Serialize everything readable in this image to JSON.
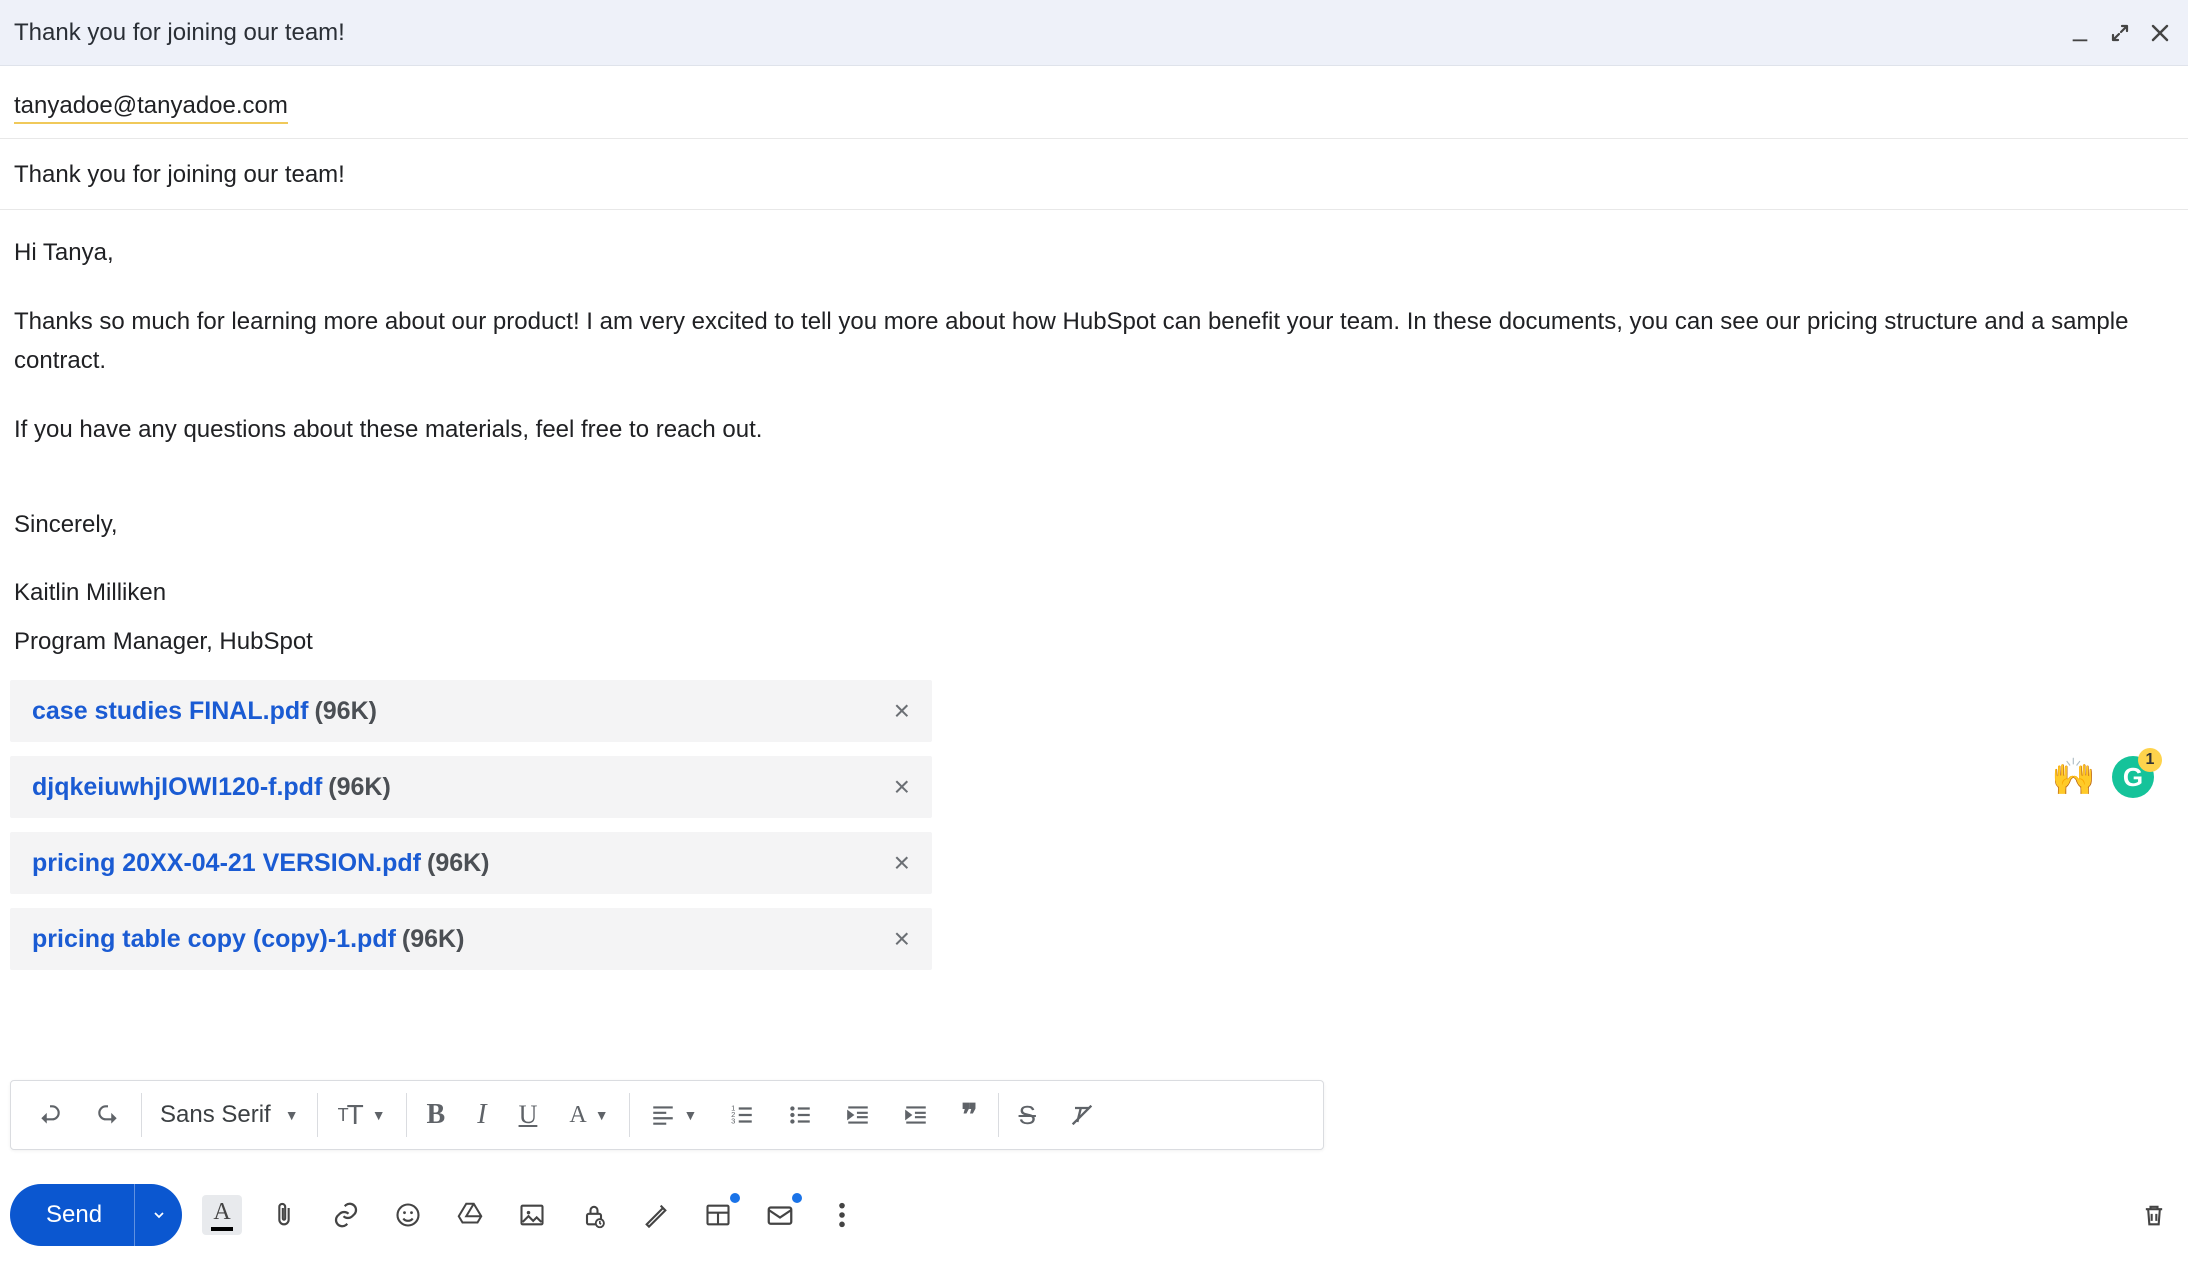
{
  "titlebar": {
    "title": "Thank you for joining our team!"
  },
  "recipient": "tanyadoe@tanyadoe.com",
  "subject": "Thank you for joining our team!",
  "body": {
    "greeting": "Hi Tanya,",
    "p1": "Thanks so much for learning more about our product! I am very excited to tell you more about how HubSpot can benefit your team. In these documents, you can see our pricing structure and a sample contract.",
    "p2": "If you have any questions about these materials, feel free to reach out.",
    "signoff": "Sincerely,",
    "name": "Kaitlin Milliken",
    "role": "Program Manager, HubSpot"
  },
  "attachments": [
    {
      "name": "case studies FINAL.pdf",
      "size": "(96K)"
    },
    {
      "name": "djqkeiuwhjIOWl120-f.pdf",
      "size": "(96K)"
    },
    {
      "name": "pricing 20XX-04-21 VERSION.pdf",
      "size": "(96K)"
    },
    {
      "name": "pricing table copy (copy)-1.pdf",
      "size": "(96K)"
    }
  ],
  "format_toolbar": {
    "font": "Sans Serif"
  },
  "grammarly_count": "1",
  "send_label": "Send"
}
